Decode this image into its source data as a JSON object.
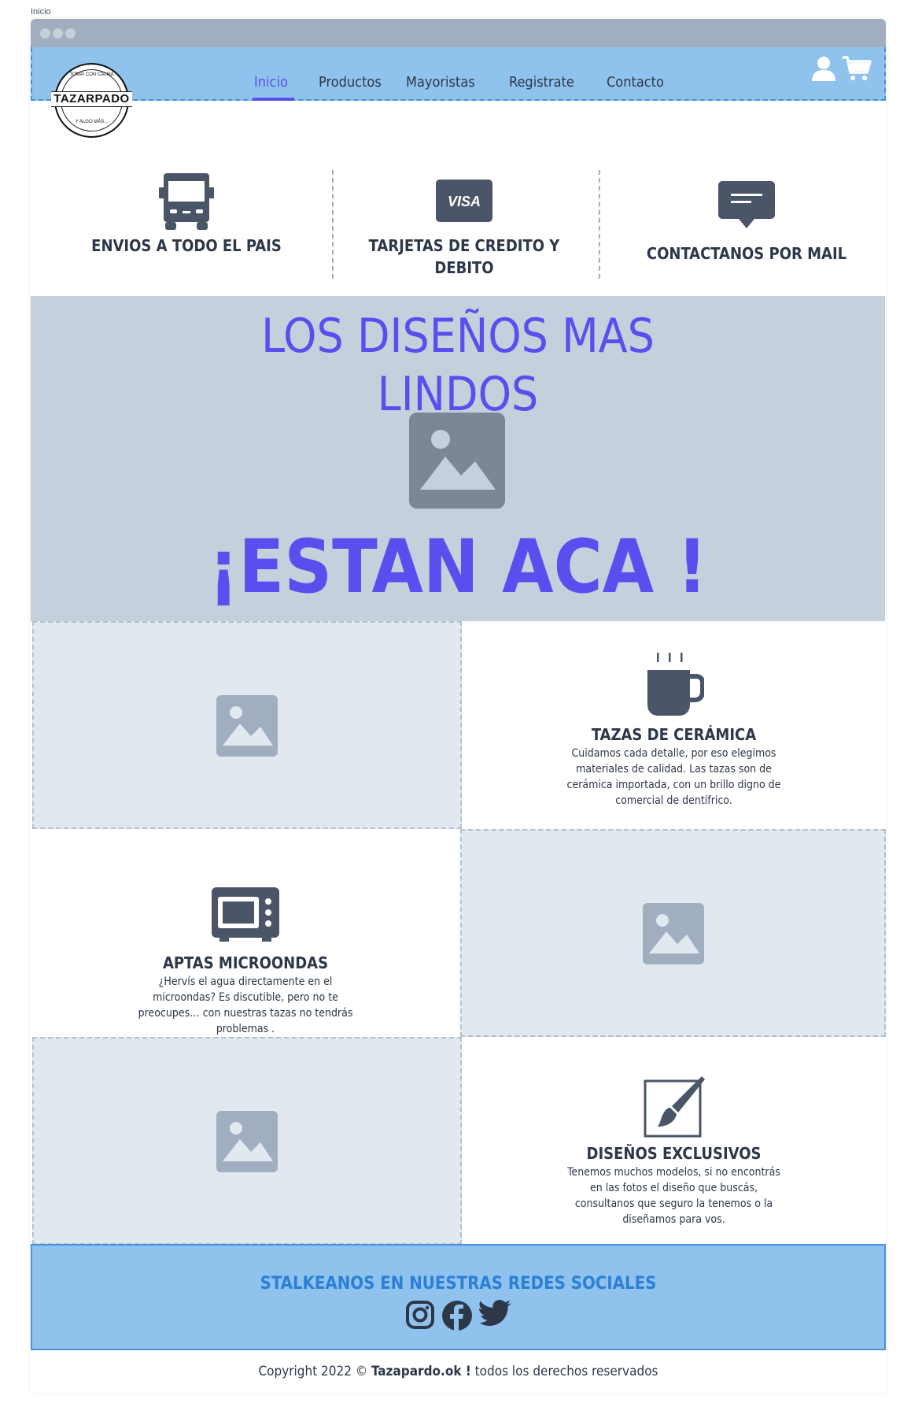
{
  "page_label": "Inicio",
  "logo": {
    "brand": "TAZARPADO",
    "top_arc": "TOMÁ! CON CALMA",
    "bottom_arc": "Y ALGO MÁS..."
  },
  "nav": {
    "items": [
      {
        "label": "Inicio",
        "active": true
      },
      {
        "label": "Productos"
      },
      {
        "label": "Mayoristas"
      },
      {
        "label": "Registrate"
      },
      {
        "label": "Contacto"
      }
    ],
    "icons": [
      "user-icon",
      "cart-icon"
    ]
  },
  "features": [
    {
      "icon": "truck-icon",
      "title": "ENVIOS A TODO EL PAIS"
    },
    {
      "icon": "visa-card-icon",
      "card_text": "VISA",
      "title": "TARJETAS DE CREDITO Y DEBITO"
    },
    {
      "icon": "chat-bubble-icon",
      "title": "CONTACTANOS POR MAIL"
    }
  ],
  "hero": {
    "heading": "LOS DISEÑOS MAS LINDOS",
    "cta": "¡ESTAN ACA !"
  },
  "blocks": [
    {
      "icon": "mug-icon",
      "title": "TAZAS DE CERÁMICA",
      "description": "Cuidamos cada detalle, por eso elegimos materiales de calidad. Las tazas son de cerámica importada, con un brillo digno de comercial de dentífrico."
    },
    {
      "icon": "microwave-icon",
      "title": "APTAS MICROONDAS",
      "description": "¿Hervís el agua directamente en el microondas? Es discutible, pero no te preocupes… con nuestras tazas no tendrás problemas ."
    },
    {
      "icon": "paintbrush-icon",
      "title": "DISEÑOS EXCLUSIVOS",
      "description": "Tenemos muchos modelos, si no encontrás en las fotos el diseño que buscás, consultanos que seguro la tenemos o la diseñamos para vos."
    }
  ],
  "social": {
    "title": "STALKEANOS EN NUESTRAS REDES SOCIALES",
    "icons": [
      "instagram-icon",
      "facebook-icon",
      "twitter-icon"
    ]
  },
  "footer": {
    "prefix": "Copyright 2022 ©",
    "brand": "Tazapardo.ok !",
    "suffix": "todos los derechos reservados"
  },
  "colors": {
    "accent": "#5a4fee",
    "navbar": "#90c2ee",
    "hero_bg": "#c4d0dc",
    "icon_dark": "#4a5568",
    "social_title": "#2b7fd6"
  }
}
